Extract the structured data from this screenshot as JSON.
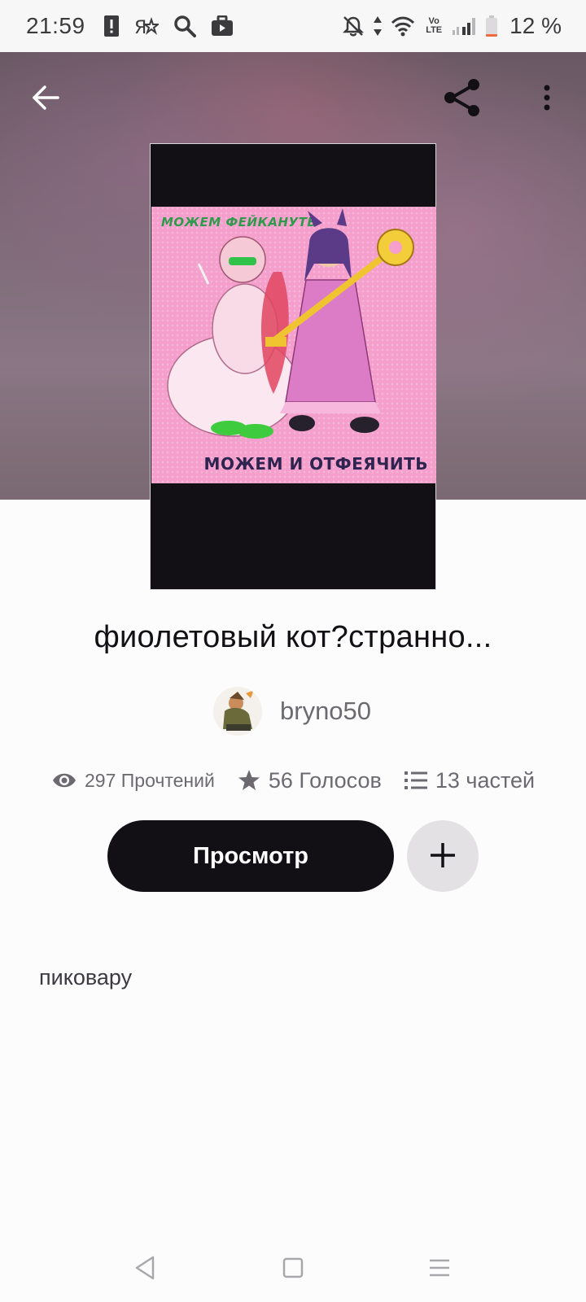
{
  "status_bar": {
    "time": "21:59",
    "notification_icons": [
      "alert-icon",
      "ya-app-icon",
      "search-icon",
      "briefcase-icon"
    ],
    "system_icons": [
      "bell-off-icon",
      "data-arrows-icon",
      "wifi-icon",
      "volte-icon",
      "signal-icon",
      "battery-icon"
    ],
    "volte_label": "Vo LTE",
    "battery_percent": "12 %",
    "battery_level": 0.12,
    "battery_color": "#f06a3d"
  },
  "header": {
    "back_icon": "arrow-left-icon",
    "share_icon": "share-icon",
    "more_icon": "more-vertical-icon"
  },
  "cover": {
    "text_top": "МОЖЕМ ФЕЙКАНУТЬ",
    "text_bottom": "МОЖЕМ И ОТФЕЯЧИТЬ",
    "background_color": "#f49fcc"
  },
  "story": {
    "title": "фиолетовый кот?странно...",
    "author": "bryno50",
    "description": "пиковару"
  },
  "stats": {
    "reads": "297 Прочтений",
    "votes": "56 Голосов",
    "parts": "13 частей"
  },
  "actions": {
    "read_label": "Просмотр",
    "add_icon": "plus-icon"
  },
  "nav": {
    "icons": [
      "back-triangle-icon",
      "home-square-icon",
      "menu-lines-icon"
    ]
  },
  "colors": {
    "primary_button": "#121014",
    "secondary_button": "#e3e1e4",
    "muted_text": "#6c6a70"
  }
}
